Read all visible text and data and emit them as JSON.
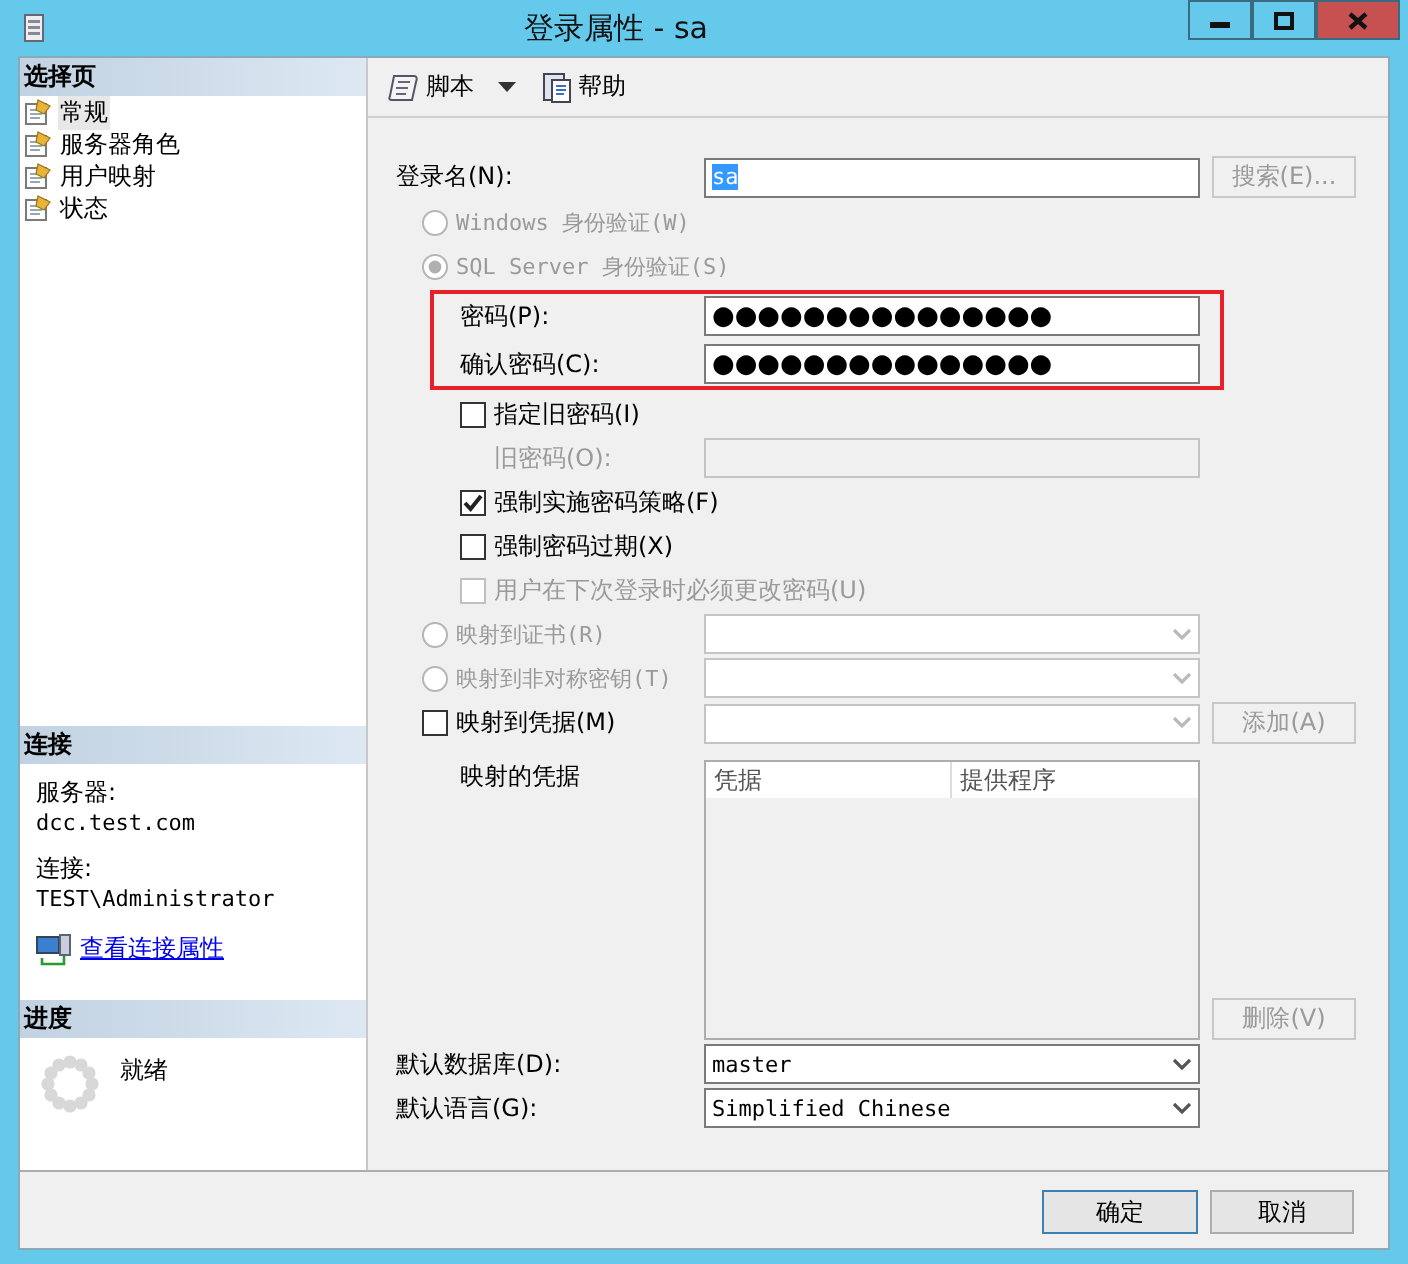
{
  "window": {
    "title": "登录属性 - sa"
  },
  "sidebar": {
    "select_page": {
      "header": "选择页",
      "pages": [
        {
          "label": "常规",
          "selected": true
        },
        {
          "label": "服务器角色",
          "selected": false
        },
        {
          "label": "用户映射",
          "selected": false
        },
        {
          "label": "状态",
          "selected": false
        }
      ]
    },
    "connection": {
      "header": "连接",
      "server_label": "服务器:",
      "server": "dcc.test.com",
      "connection_label": "连接:",
      "connection": "TEST\\Administrator",
      "link": "查看连接属性"
    },
    "progress": {
      "header": "进度",
      "status": "就绪"
    }
  },
  "toolbar": {
    "items": [
      {
        "kind": "script",
        "label": "脚本"
      },
      {
        "kind": "help",
        "label": "帮助"
      }
    ]
  },
  "form": {
    "rows": [
      {
        "kind": "text",
        "label": "登录名(N):",
        "value": "sa",
        "value_selected": true,
        "button": {
          "label": "搜索(E)...",
          "disabled": true
        }
      },
      {
        "kind": "radio",
        "label": "Windows 身份验证(W)",
        "selected": false,
        "disabled": true
      },
      {
        "kind": "radio",
        "label": "SQL Server 身份验证(S)",
        "selected": true,
        "disabled": true,
        "children": [
          {
            "kind": "password",
            "label": "密码(P):",
            "value": "●●●●●●●●●●●●●●●",
            "highlighted": true
          },
          {
            "kind": "password",
            "label": "确认密码(C):",
            "value": "●●●●●●●●●●●●●●●",
            "highlighted": true
          },
          {
            "kind": "checkbox",
            "label": "指定旧密码(I)",
            "checked": false,
            "disabled": false,
            "children": [
              {
                "kind": "text",
                "label": "旧密码(O):",
                "disabled": true
              }
            ]
          },
          {
            "kind": "checkbox",
            "label": "强制实施密码策略(F)",
            "checked": true,
            "disabled": false
          },
          {
            "kind": "checkbox",
            "label": "强制密码过期(X)",
            "checked": false,
            "disabled": false
          },
          {
            "kind": "checkbox",
            "label": "用户在下次登录时必须更改密码(U)",
            "checked": false,
            "disabled": true
          }
        ]
      },
      {
        "kind": "radio",
        "label": "映射到证书(R)",
        "selected": false,
        "disabled": true,
        "combo": {
          "disabled": true
        }
      },
      {
        "kind": "radio",
        "label": "映射到非对称密钥(T)",
        "selected": false,
        "disabled": true,
        "combo": {
          "disabled": true
        }
      },
      {
        "kind": "checkbox",
        "label": "映射到凭据(M)",
        "checked": false,
        "disabled": false,
        "combo": {
          "disabled": true
        },
        "button": {
          "label": "添加(A)",
          "disabled": true
        },
        "children": [
          {
            "kind": "grid",
            "label": "映射的凭据",
            "columns": [
              "凭据",
              "提供程序"
            ],
            "button": {
              "label": "删除(V)",
              "disabled": true
            }
          }
        ]
      },
      {
        "kind": "combo",
        "label": "默认数据库(D):",
        "value": "master"
      },
      {
        "kind": "combo",
        "label": "默认语言(G):",
        "value": "Simplified Chinese"
      }
    ]
  },
  "buttons": [
    {
      "label": "确定"
    },
    {
      "label": "取消"
    }
  ]
}
